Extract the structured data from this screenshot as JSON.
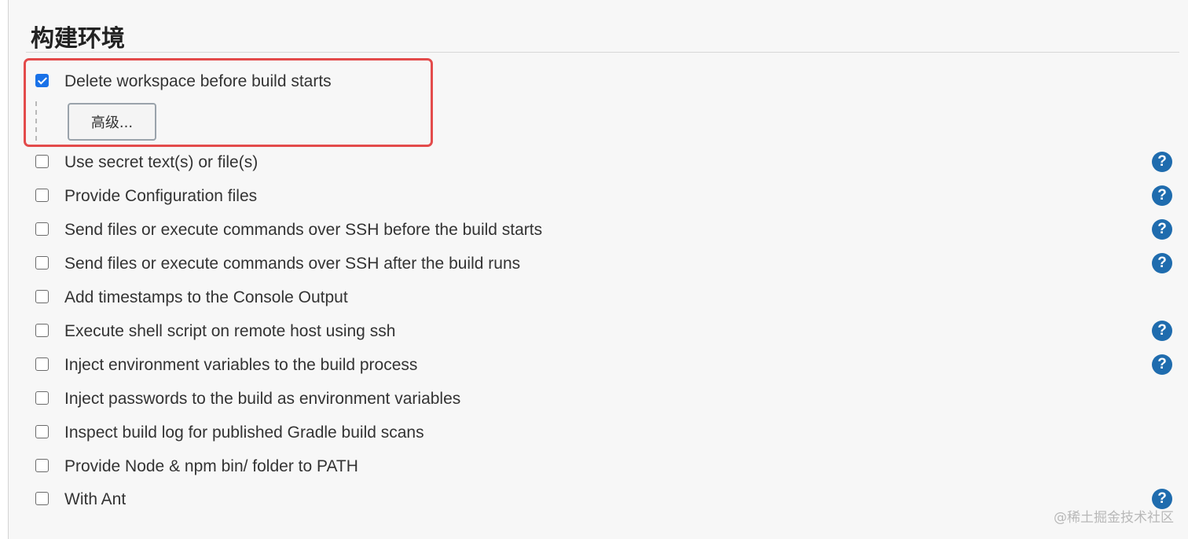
{
  "section": {
    "title": "构建环境"
  },
  "options": [
    {
      "label": "Delete workspace before build starts",
      "checked": true,
      "help": false
    },
    {
      "label": "Use secret text(s) or file(s)",
      "checked": false,
      "help": true
    },
    {
      "label": "Provide Configuration files",
      "checked": false,
      "help": true
    },
    {
      "label": "Send files or execute commands over SSH before the build starts",
      "checked": false,
      "help": true
    },
    {
      "label": "Send files or execute commands over SSH after the build runs",
      "checked": false,
      "help": true
    },
    {
      "label": "Add timestamps to the Console Output",
      "checked": false,
      "help": false
    },
    {
      "label": "Execute shell script on remote host using ssh",
      "checked": false,
      "help": true
    },
    {
      "label": "Inject environment variables to the build process",
      "checked": false,
      "help": true
    },
    {
      "label": "Inject passwords to the build as environment variables",
      "checked": false,
      "help": false
    },
    {
      "label": "Inspect build log for published Gradle build scans",
      "checked": false,
      "help": false
    },
    {
      "label": "Provide Node & npm bin/ folder to PATH",
      "checked": false,
      "help": false
    },
    {
      "label": "With Ant",
      "checked": false,
      "help": true
    }
  ],
  "advanced_button": {
    "label": "高级..."
  },
  "help_icon": {
    "glyph": "?",
    "icon": "help-icon",
    "color": "#1f6cae"
  },
  "highlight_color": "#e34b4b",
  "watermark": "@稀土掘金技术社区"
}
